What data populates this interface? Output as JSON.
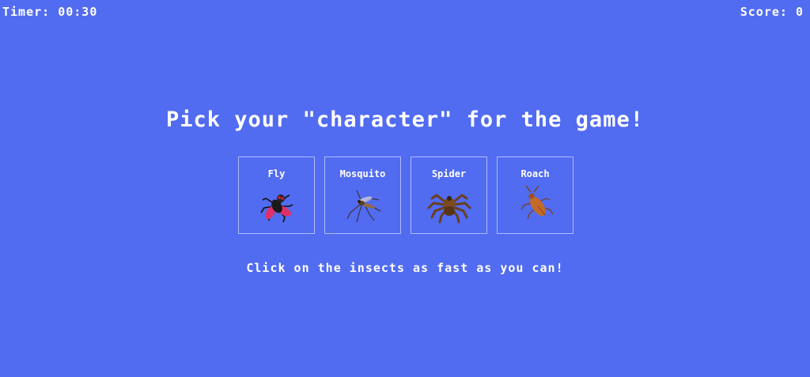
{
  "hud": {
    "timer": "Timer: 00:30",
    "score": "Score: 0"
  },
  "screen": {
    "title": "Pick your \"character\" for the game!",
    "hint": "Click on the insects as fast as you can!"
  },
  "characters": [
    {
      "label": "Fly",
      "icon": "fly-icon"
    },
    {
      "label": "Mosquito",
      "icon": "mosquito-icon"
    },
    {
      "label": "Spider",
      "icon": "spider-icon"
    },
    {
      "label": "Roach",
      "icon": "roach-icon"
    }
  ],
  "colors": {
    "background": "#516bf1",
    "text": "#ffffff"
  }
}
